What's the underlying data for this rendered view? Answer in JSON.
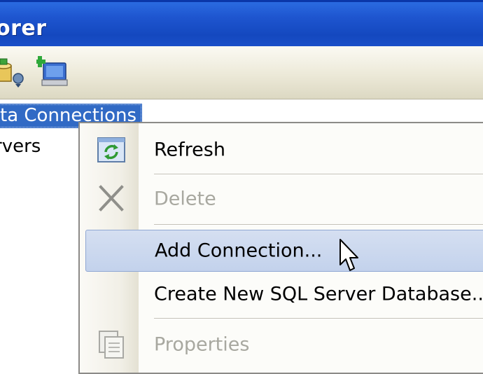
{
  "window": {
    "title": "orer"
  },
  "toolbar": {
    "buttons": [
      {
        "icon": "connect-to-database-icon"
      },
      {
        "icon": "connect-to-server-icon"
      }
    ]
  },
  "tree": {
    "nodes": [
      {
        "label": "ta Connections",
        "selected": true
      },
      {
        "label": "rvers",
        "selected": false
      }
    ]
  },
  "context_menu": {
    "items": [
      {
        "label": "Refresh",
        "icon": "refresh-icon",
        "enabled": true
      },
      {
        "label": "Delete",
        "icon": "delete-icon",
        "enabled": false
      },
      {
        "label": "Add Connection...",
        "icon": "",
        "enabled": true,
        "hovered": true
      },
      {
        "label": "Create New SQL Server Database...",
        "icon": "",
        "enabled": true
      },
      {
        "label": "Properties",
        "icon": "properties-icon",
        "enabled": false
      }
    ]
  },
  "colors": {
    "titlebar": "#1e55cf",
    "selection": "#316ac5",
    "menu_hover": "#c3d2ec",
    "disabled_text": "#a8a8a0"
  }
}
